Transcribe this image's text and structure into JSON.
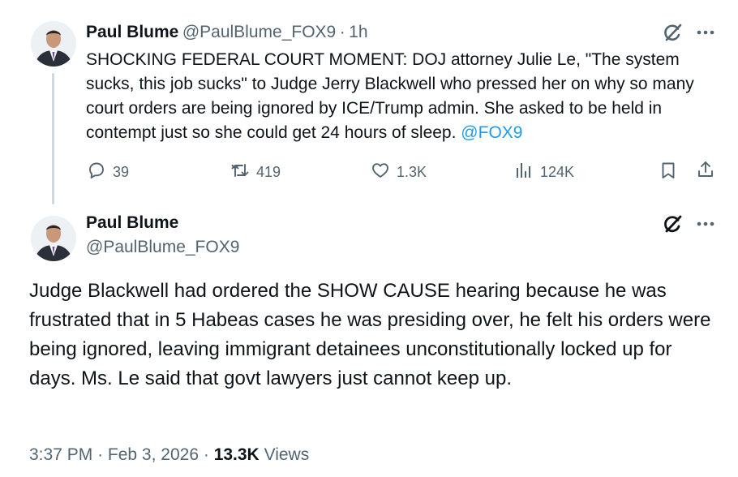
{
  "tweet1": {
    "author_name": "Paul Blume",
    "author_handle": "@PaulBlume_FOX9",
    "time": "1h",
    "text": "SHOCKING FEDERAL COURT MOMENT: DOJ attorney Julie Le, \"The system sucks, this job sucks\" to Judge Jerry Blackwell who pressed her on why so many court orders are being ignored by ICE/Trump admin. She asked to be held in contempt just so she could get 24 hours of sleep.",
    "mention": "@FOX9",
    "replies": "39",
    "reposts": "419",
    "likes": "1.3K",
    "views": "124K"
  },
  "tweet2": {
    "author_name": "Paul Blume",
    "author_handle": "@PaulBlume_FOX9",
    "text": "Judge Blackwell had ordered the SHOW CAUSE hearing because he was frustrated that in 5 Habeas cases he was presiding over, he felt his orders were being ignored, leaving immigrant detainees unconstitutionally locked up for days. Ms. Le said that govt lawyers just cannot  keep up.",
    "time": "3:37 PM",
    "date": "Feb 3, 2026",
    "views_count": "13.3K",
    "views_label": "Views"
  },
  "colors": {
    "text": "#0f1419",
    "secondary": "#536471",
    "link": "#1d9bf0",
    "thread_line": "#cfd9de"
  },
  "icons": [
    "grok-icon",
    "more-icon",
    "reply-icon",
    "repost-icon",
    "like-icon",
    "views-icon",
    "bookmark-icon",
    "share-icon"
  ]
}
